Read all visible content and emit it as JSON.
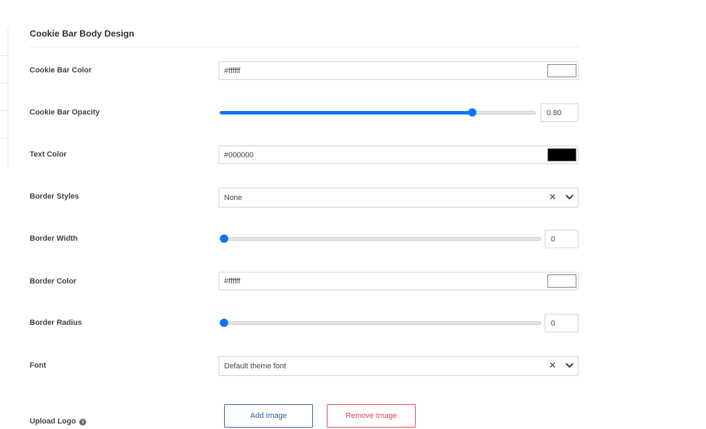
{
  "section": {
    "title": "Cookie Bar Body Design"
  },
  "fields": {
    "cookie_bar_color": {
      "label": "Cookie Bar Color",
      "value": "#ffffff",
      "swatch": "#ffffff"
    },
    "cookie_bar_opacity": {
      "label": "Cookie Bar Opacity",
      "value": "0.80",
      "slider_fraction": 0.8
    },
    "text_color": {
      "label": "Text Color",
      "value": "#000000",
      "swatch": "#000000"
    },
    "border_styles": {
      "label": "Border Styles",
      "value": "None"
    },
    "border_width": {
      "label": "Border Width",
      "value": "0",
      "slider_fraction": 0
    },
    "border_color": {
      "label": "Border Color",
      "value": "#ffffff",
      "swatch": "#ffffff"
    },
    "border_radius": {
      "label": "Border Radius",
      "value": "0",
      "slider_fraction": 0
    },
    "font": {
      "label": "Font",
      "value": "Default theme font"
    },
    "upload_logo": {
      "label": "Upload Logo",
      "add_label": "Add Image",
      "remove_label": "Remove Image"
    }
  },
  "icons": {
    "clear": "close-icon",
    "dropdown": "chevron-down-icon",
    "info": "info-icon"
  },
  "colors": {
    "accent": "#0a74ff",
    "add_button": "#2c5aa0",
    "remove_button": "#e0484f"
  }
}
